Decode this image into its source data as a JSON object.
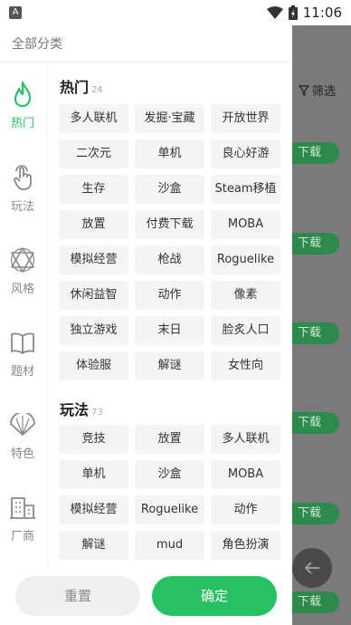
{
  "status_bar": {
    "time": "11:06"
  },
  "drawer": {
    "title": "全部分类",
    "sidebar": [
      {
        "label": "热门",
        "icon": "flame-icon",
        "active": true
      },
      {
        "label": "玩法",
        "icon": "tap-hand-icon",
        "active": false
      },
      {
        "label": "风格",
        "icon": "hexagram-icon",
        "active": false
      },
      {
        "label": "题材",
        "icon": "open-book-icon",
        "active": false
      },
      {
        "label": "特色",
        "icon": "fan-icon",
        "active": false
      },
      {
        "label": "厂商",
        "icon": "building-icon",
        "active": false
      }
    ],
    "sections": [
      {
        "title": "热门",
        "count": "24",
        "tags": [
          "多人联机",
          "发掘·宝藏",
          "开放世界",
          "二次元",
          "单机",
          "良心好游",
          "生存",
          "沙盒",
          "Steam移植",
          "放置",
          "付费下载",
          "MOBA",
          "模拟经营",
          "枪战",
          "Roguelike",
          "休闲益智",
          "动作",
          "像素",
          "独立游戏",
          "末日",
          "脸炙人口",
          "体验服",
          "解谜",
          "女性向"
        ]
      },
      {
        "title": "玩法",
        "count": "73",
        "tags": [
          "竞技",
          "放置",
          "多人联机",
          "单机",
          "沙盒",
          "MOBA",
          "模拟经营",
          "Roguelike",
          "动作",
          "解谜",
          "mud",
          "角色扮演"
        ]
      }
    ],
    "footer": {
      "reset_label": "重置",
      "confirm_label": "确定"
    }
  },
  "background": {
    "filter_label": "筛选",
    "download_label": "下载"
  },
  "colors": {
    "accent": "#27c062",
    "muted": "#888888"
  }
}
